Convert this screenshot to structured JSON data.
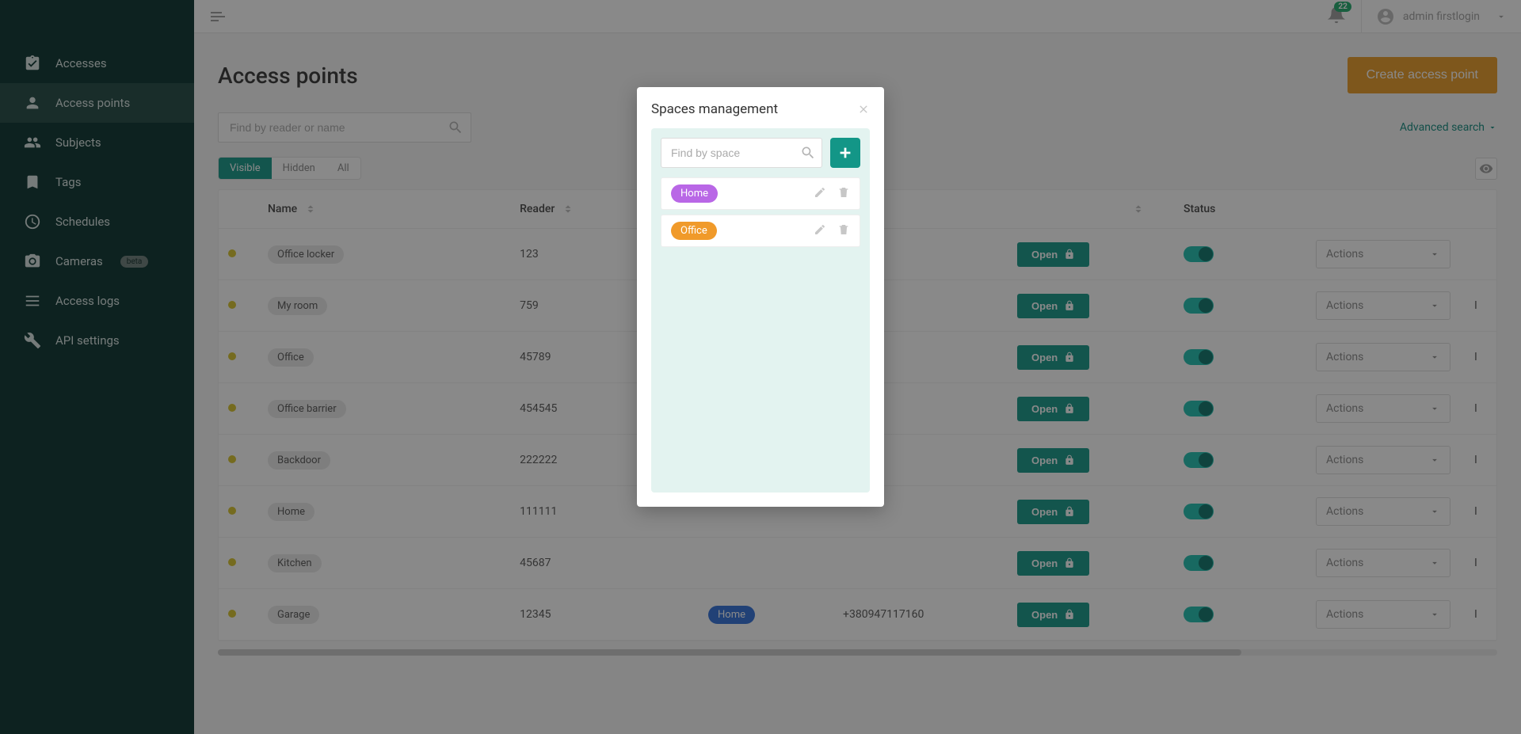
{
  "sidebar": {
    "items": [
      {
        "label": "Accesses"
      },
      {
        "label": "Access points"
      },
      {
        "label": "Subjects"
      },
      {
        "label": "Tags"
      },
      {
        "label": "Schedules"
      },
      {
        "label": "Cameras",
        "badge": "beta"
      },
      {
        "label": "Access logs"
      },
      {
        "label": "API settings"
      }
    ]
  },
  "topbar": {
    "notifications": "22",
    "username": "admin firstlogin"
  },
  "page": {
    "title": "Access points",
    "create_btn": "Create access point",
    "search_placeholder": "Find by reader or name",
    "advanced_search": "Advanced search",
    "tabs": {
      "visible": "Visible",
      "hidden": "Hidden",
      "all": "All"
    },
    "columns": {
      "name": "Name",
      "reader": "Reader",
      "status": "Status"
    },
    "open_label": "Open",
    "actions_label": "Actions",
    "indicator_label": "I"
  },
  "rows": [
    {
      "name": "Office locker",
      "reader": "123"
    },
    {
      "name": "My room",
      "reader": "759"
    },
    {
      "name": "Office",
      "reader": "45789"
    },
    {
      "name": "Office barrier",
      "reader": "454545"
    },
    {
      "name": "Backdoor",
      "reader": "222222"
    },
    {
      "name": "Home",
      "reader": "111111"
    },
    {
      "name": "Kitchen",
      "reader": "45687"
    },
    {
      "name": "Garage",
      "reader": "12345",
      "space": "Home",
      "phone": "+380947117160"
    }
  ],
  "modal": {
    "title": "Spaces management",
    "search_placeholder": "Find by space",
    "spaces": [
      {
        "name": "Home",
        "color": "purple"
      },
      {
        "name": "Office",
        "color": "orange"
      }
    ]
  }
}
